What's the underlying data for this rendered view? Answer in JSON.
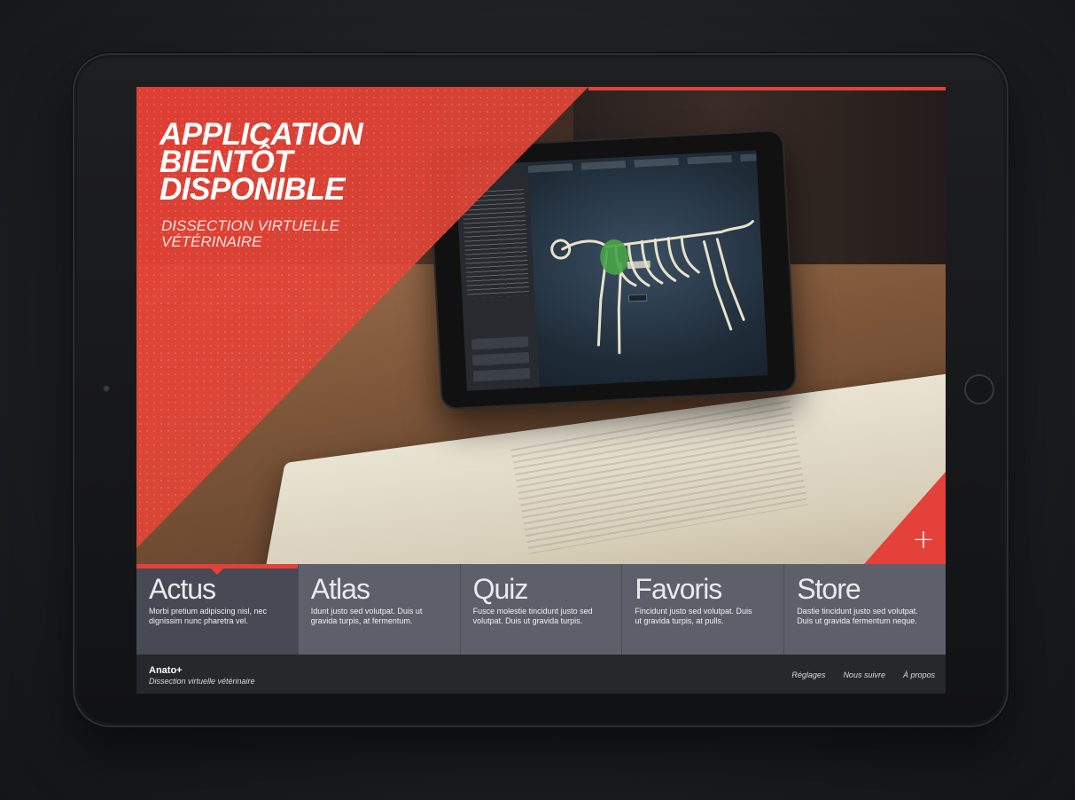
{
  "hero": {
    "title": "APPLICATION\nBIENTÔT\nDISPONIBLE",
    "subtitle": "DISSECTION VIRTUELLE\nVÉTÉRINAIRE",
    "plus_icon": "+"
  },
  "tiles": [
    {
      "title": "Actus",
      "desc": "Morbi pretium adipiscing nisl, nec dignissim nunc pharetra vel."
    },
    {
      "title": "Atlas",
      "desc": "Idunt justo sed volutpat. Duis ut gravida turpis, at fermentum."
    },
    {
      "title": "Quiz",
      "desc": "Fusce molestie tincidunt justo sed volutpat. Duis ut gravida turpis."
    },
    {
      "title": "Favoris",
      "desc": "Fincidunt justo sed volutpat. Duis ut gravida turpis, at pulls."
    },
    {
      "title": "Store",
      "desc": "Dastie tincidunt justo sed volutpat. Duis ut gravida fermentum neque."
    }
  ],
  "footer": {
    "brand": "Anato+",
    "brand_sub": "Dissection virtuelle vétérinaire",
    "links": [
      "Réglages",
      "Nous suivre",
      "À propos"
    ]
  },
  "colors": {
    "accent": "#e4413a",
    "tile_bg": "#5d606b",
    "tile_active_bg": "#474a55",
    "footer_bg": "#26282c"
  }
}
